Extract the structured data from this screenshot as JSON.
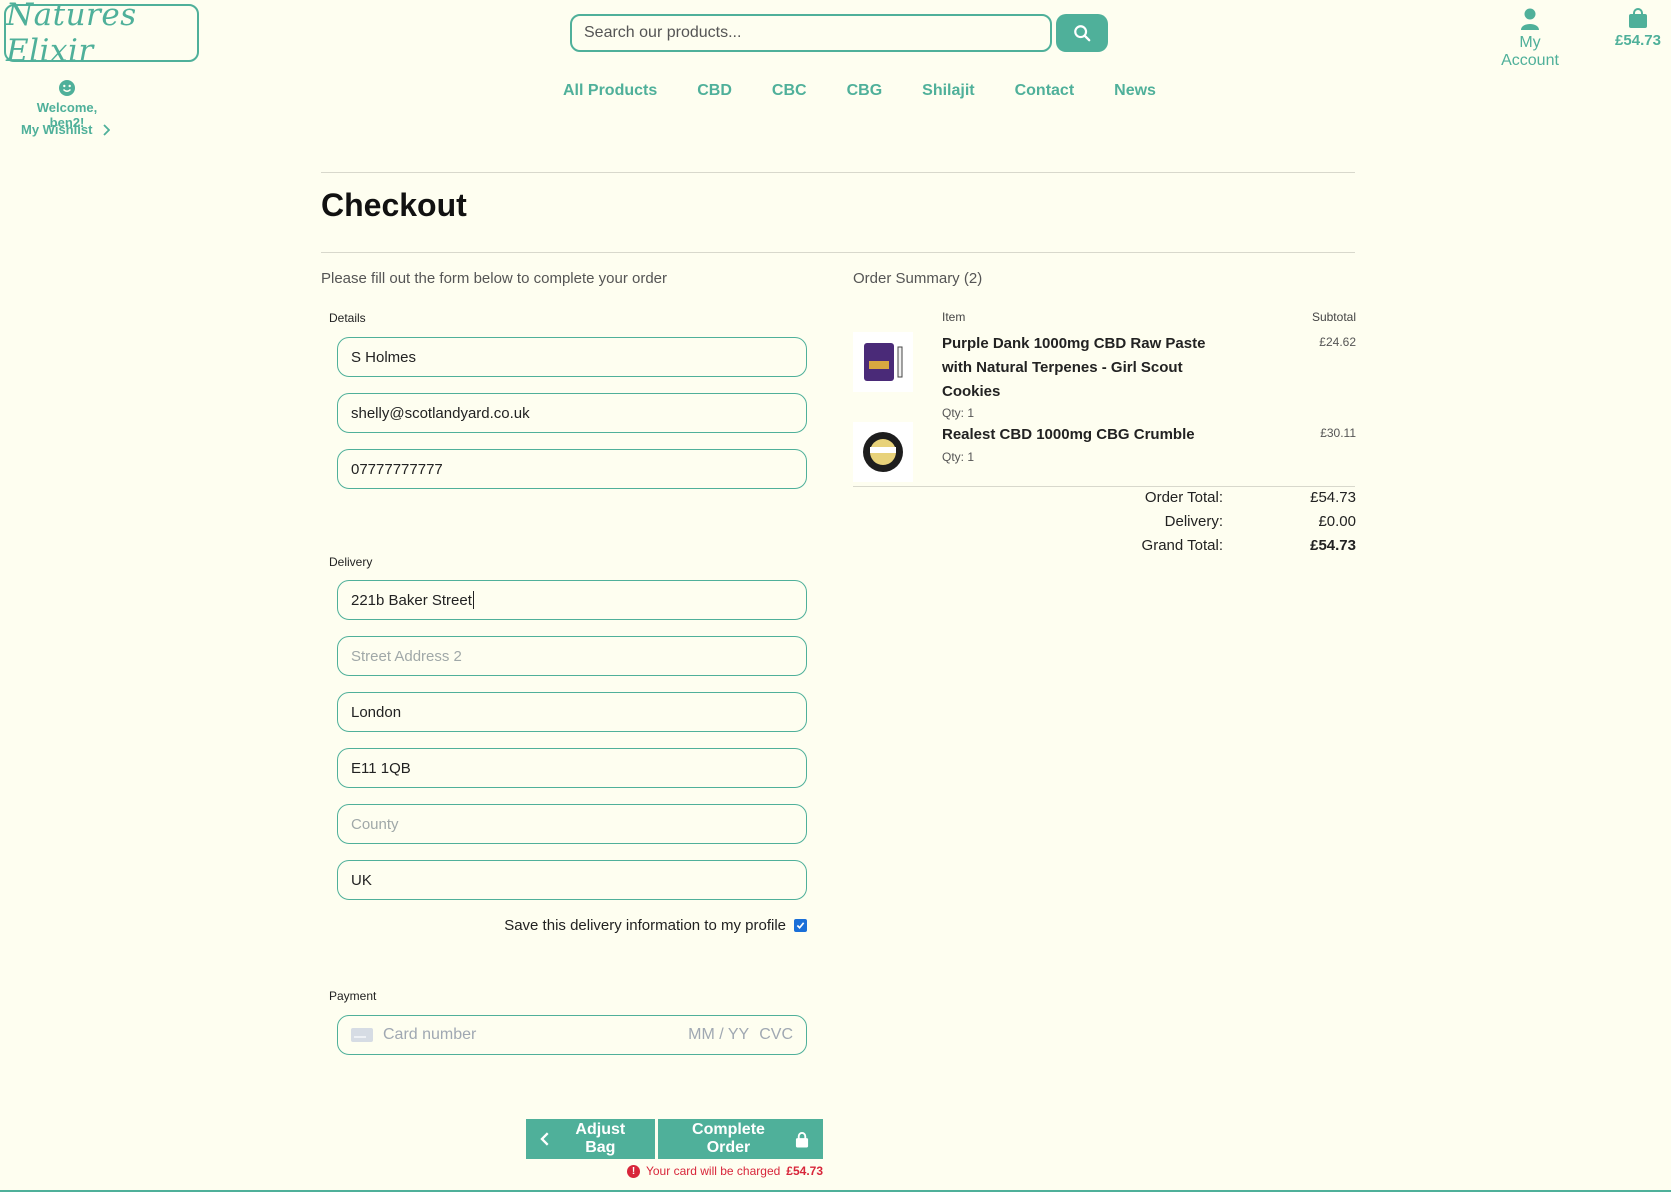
{
  "header": {
    "logo_text": "Natures Elixir",
    "search_placeholder": "Search our products...",
    "account_label": "My Account",
    "bag_total": "£54.73",
    "welcome": "Welcome, ben2!",
    "wishlist_label": "My Wishlist"
  },
  "nav": {
    "items": [
      "All Products",
      "CBD",
      "CBC",
      "CBG",
      "Shilajit",
      "Contact",
      "News"
    ]
  },
  "checkout": {
    "title": "Checkout",
    "intro": "Please fill out the form below to complete your order",
    "details_label": "Details",
    "full_name": "S Holmes",
    "email": "shelly@scotlandyard.co.uk",
    "phone": "07777777777",
    "delivery_label": "Delivery",
    "street1": "221b Baker Street",
    "street2_placeholder": "Street Address 2",
    "town": "London",
    "postcode": "E11 1QB",
    "county_placeholder": "County",
    "country": "UK",
    "save_info_label": "Save this delivery information to my profile",
    "save_info_checked": true,
    "payment_label": "Payment",
    "card_placeholder": "Card number",
    "expiry_placeholder": "MM / YY",
    "cvc_placeholder": "CVC",
    "adjust_bag_label": "Adjust Bag",
    "complete_order_label": "Complete Order",
    "charge_text": "Your card will be charged",
    "charge_amount": "£54.73"
  },
  "summary": {
    "title": "Order Summary (2)",
    "item_header": "Item",
    "subtotal_header": "Subtotal",
    "items": [
      {
        "name": "Purple Dank 1000mg CBD Raw Paste with Natural Terpenes - Girl Scout Cookies",
        "qty": "Qty: 1",
        "price": "£24.62"
      },
      {
        "name": "Realest CBD 1000mg CBG Crumble",
        "qty": "Qty: 1",
        "price": "£30.11"
      }
    ],
    "order_total_label": "Order Total:",
    "order_total": "£54.73",
    "delivery_label": "Delivery:",
    "delivery": "£0.00",
    "grand_total_label": "Grand Total:",
    "grand_total": "£54.73"
  },
  "colors": {
    "accent": "#4fb09a",
    "background": "#fefef0",
    "error": "#d8263a"
  }
}
